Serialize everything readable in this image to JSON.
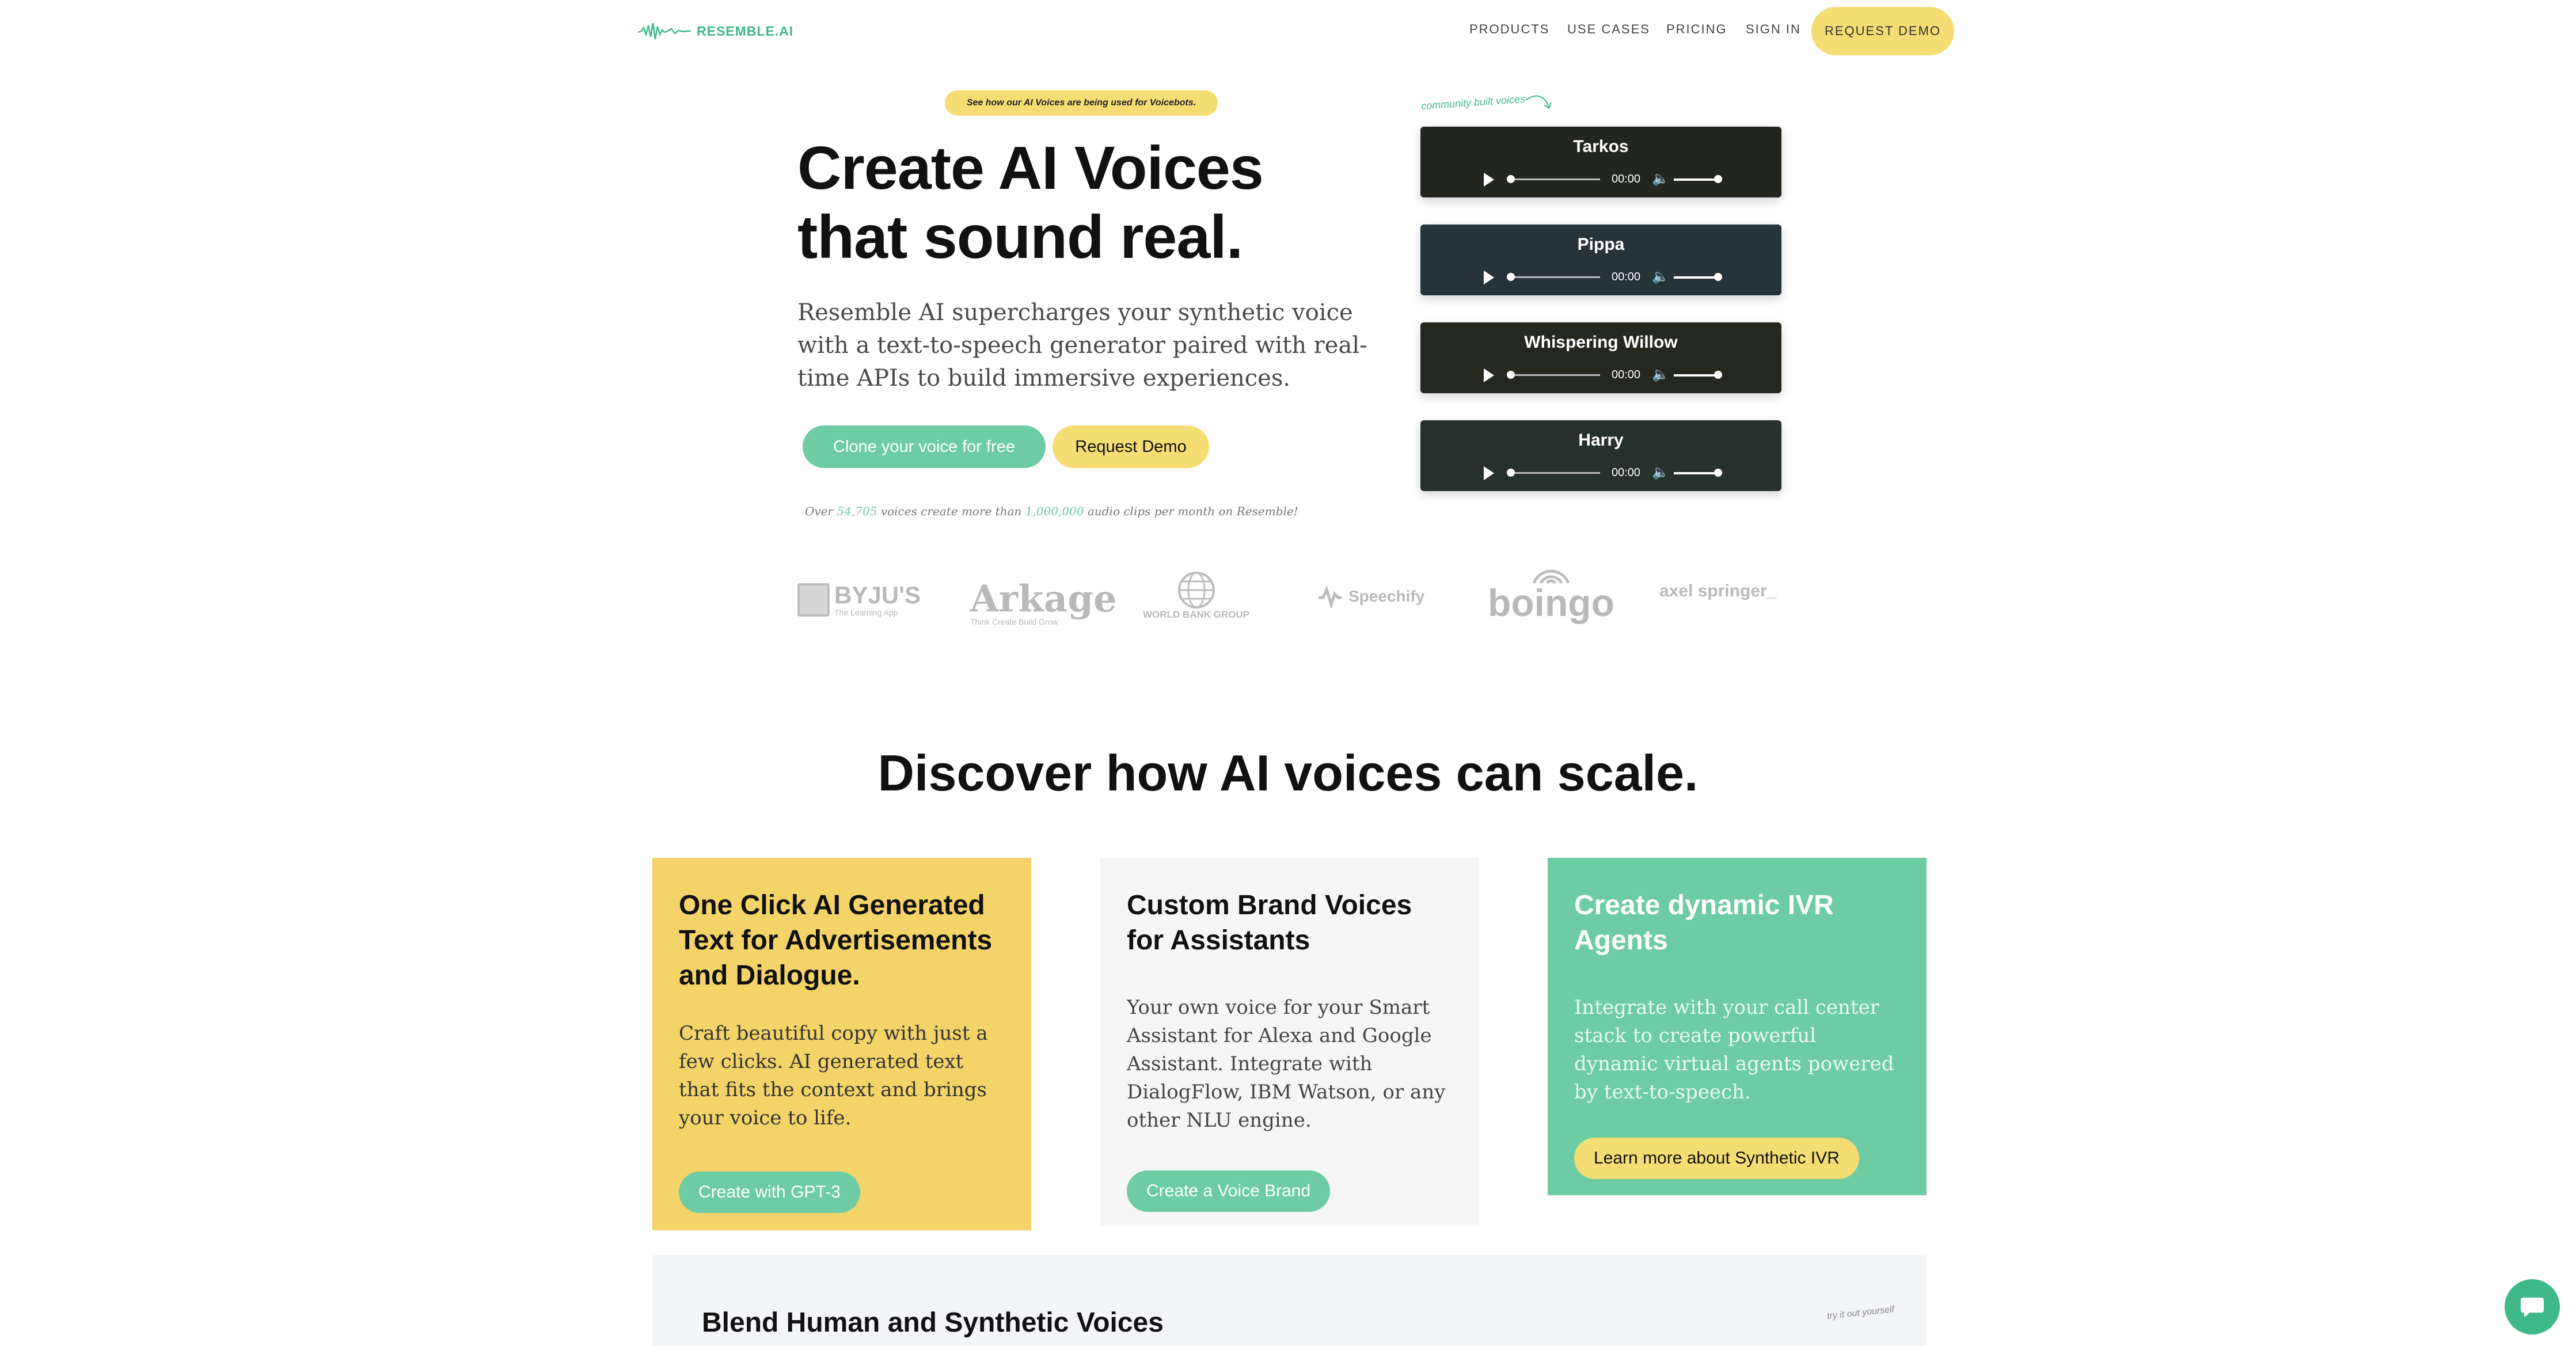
{
  "nav": {
    "logo_text": "RESEMBLE.AI",
    "items": [
      "PRODUCTS",
      "USE CASES",
      "PRICING",
      "SIGN IN"
    ],
    "cta": "REQUEST DEMO"
  },
  "hero": {
    "top_pill": "See how our AI Voices are being used for Voicebots.",
    "title_line1": "Create AI Voices",
    "title_line2": "that sound real.",
    "subtitle": "Resemble AI supercharges your synthetic voice with a text-to-speech generator paired with real-time APIs to build immersive experiences.",
    "primary_button": "Clone your voice for free",
    "secondary_button": "Request Demo",
    "stats": {
      "prefix": "Over",
      "voices": "54,705",
      "middle": "voices create more than",
      "clips": "1,000,000",
      "suffix": "audio clips per month on Resemble!"
    }
  },
  "voices": {
    "note": "community built voices",
    "players": [
      {
        "name": "Tarkos",
        "time": "00:00",
        "color": "#22261f"
      },
      {
        "name": "Pippa",
        "time": "00:00",
        "color": "#26343a"
      },
      {
        "name": "Whispering Willow",
        "time": "00:00",
        "color": "#25281f"
      },
      {
        "name": "Harry",
        "time": "00:00",
        "color": "#26302c"
      }
    ]
  },
  "logos": {
    "byjus": "BYJU'S",
    "byjus_sub": "The Learning App",
    "arkage": "Arkage",
    "arkage_sub": "Think Create Build Grow",
    "worldbank": "WORLD BANK GROUP",
    "speechify": "Speechify",
    "boingo": "boingo",
    "axel": "axel springer_"
  },
  "section": {
    "title": "Discover how AI voices can scale."
  },
  "cards": [
    {
      "title": "One Click AI Generated Text for Advertisements and Dialogue.",
      "body": "Craft beautiful copy with just a few clicks. AI generated text that fits the context and brings your voice to life.",
      "button": "Create with GPT-3"
    },
    {
      "title": "Custom Brand Voices for Assistants",
      "body": "Your own voice for your Smart Assistant for Alexa and Google Assistant. Integrate with DialogFlow, IBM Watson, or any other NLU engine.",
      "button": "Create a Voice Brand"
    },
    {
      "title": "Create dynamic IVR Agents",
      "body": "Integrate with your call center stack to create powerful dynamic virtual agents powered by text-to-speech.",
      "button": "Learn more about Synthetic IVR"
    }
  ],
  "blend": {
    "title": "Blend Human and Synthetic Voices with Resemble Fill",
    "note": "try it out yourself"
  },
  "colors": {
    "accent_green": "#6dcca4",
    "accent_yellow": "#f4de74",
    "card_yellow": "#f4d468"
  }
}
